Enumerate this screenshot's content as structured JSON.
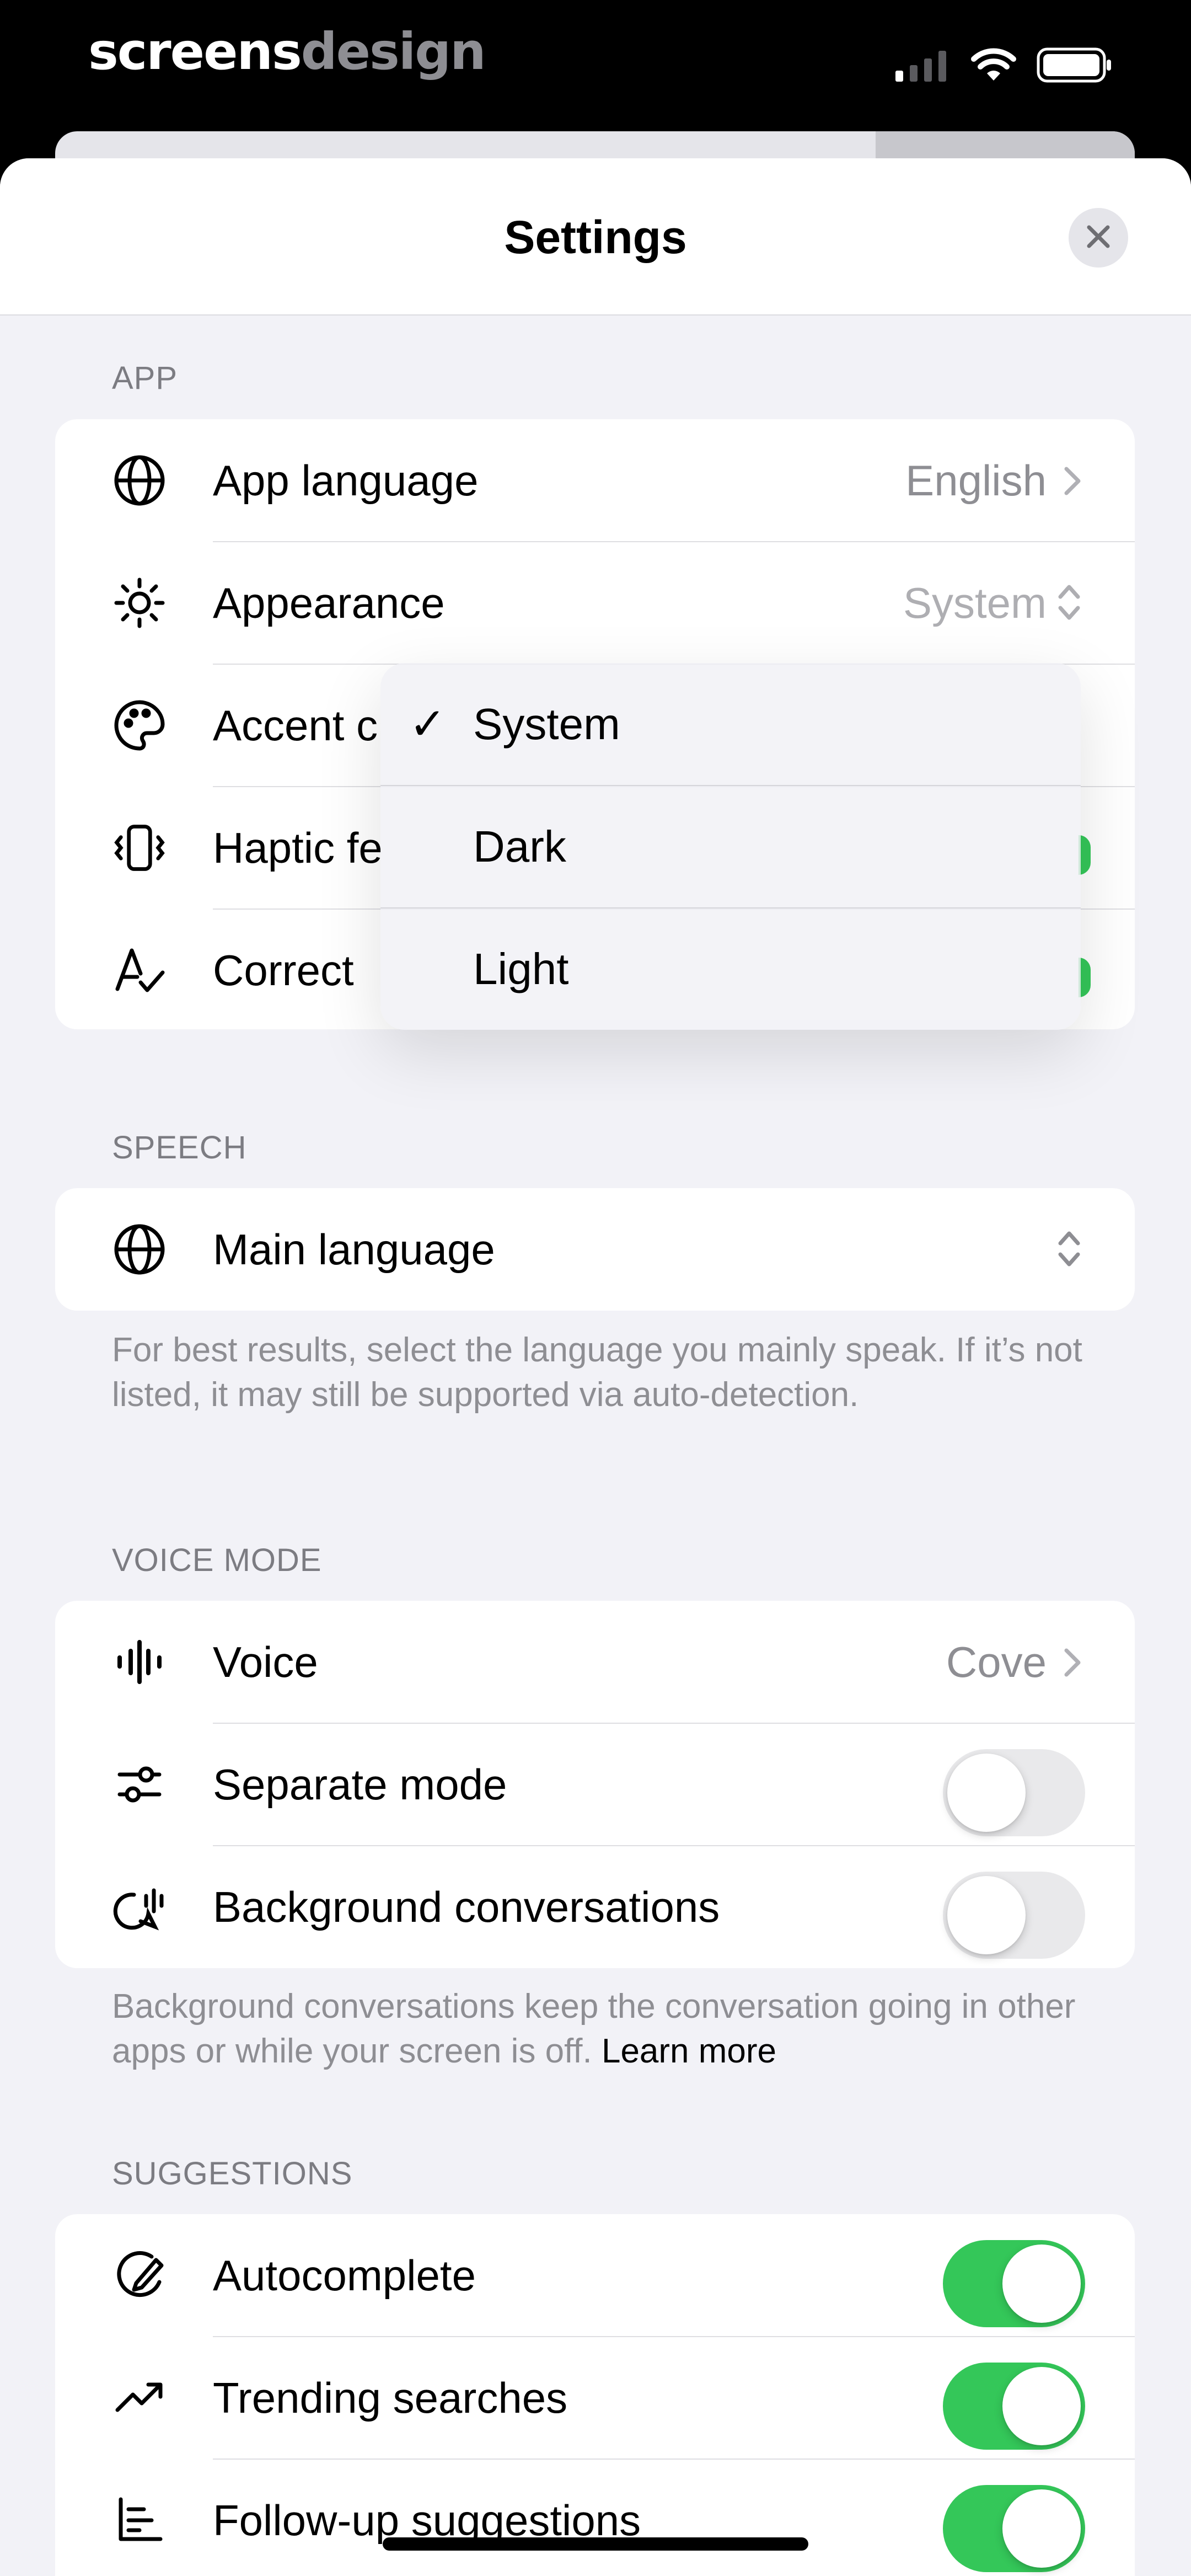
{
  "status_bar": {
    "brand_part1": "screens",
    "brand_part2": "design",
    "icons": [
      "cellular-signal-icon",
      "wifi-icon",
      "battery-icon"
    ]
  },
  "header": {
    "title": "Settings",
    "close_icon": "close-icon"
  },
  "sections": {
    "app": {
      "label": "APP",
      "rows": [
        {
          "label": "App language",
          "value": "English",
          "icon": "globe-icon",
          "control": "chevron-right"
        },
        {
          "label": "Appearance",
          "value": "System",
          "icon": "sun-icon",
          "control": "chevron-updown"
        },
        {
          "label": "Accent c",
          "icon": "palette-icon"
        },
        {
          "label": "Haptic fe",
          "icon": "haptic-icon"
        },
        {
          "label": "Correct",
          "icon": "text-correction-icon"
        }
      ]
    },
    "speech": {
      "label": "SPEECH",
      "rows": [
        {
          "label": "Main language",
          "icon": "globe-icon",
          "control": "chevron-updown"
        }
      ],
      "footnote": "For best results, select the language you mainly speak. If it’s not listed, it may still be supported via auto-detection."
    },
    "voice_mode": {
      "label": "VOICE MODE",
      "rows": [
        {
          "label": "Voice",
          "value": "Cove",
          "icon": "waveform-icon",
          "control": "chevron-right"
        },
        {
          "label": "Separate mode",
          "icon": "sliders-icon",
          "toggle": false
        },
        {
          "label": "Background conversations",
          "icon": "background-voice-icon",
          "toggle": false
        }
      ],
      "footnote": "Background conversations keep the conversation going in other apps or while your screen is off.",
      "footnote_link": "Learn more"
    },
    "suggestions": {
      "label": "SUGGESTIONS",
      "rows": [
        {
          "label": "Autocomplete",
          "icon": "autocomplete-icon",
          "toggle": true
        },
        {
          "label": "Trending searches",
          "icon": "trending-icon",
          "toggle": true
        },
        {
          "label": "Follow-up suggestions",
          "icon": "follow-up-icon",
          "toggle": true
        }
      ]
    }
  },
  "appearance_menu": {
    "options": [
      {
        "label": "System",
        "selected": true,
        "check": "✓"
      },
      {
        "label": "Dark",
        "selected": false
      },
      {
        "label": "Light",
        "selected": false
      }
    ]
  },
  "colors": {
    "toggle_on": "#34c759",
    "toggle_off": "#e9e9eb",
    "secondary_text": "#8e8e93",
    "background": "#f2f2f7"
  }
}
